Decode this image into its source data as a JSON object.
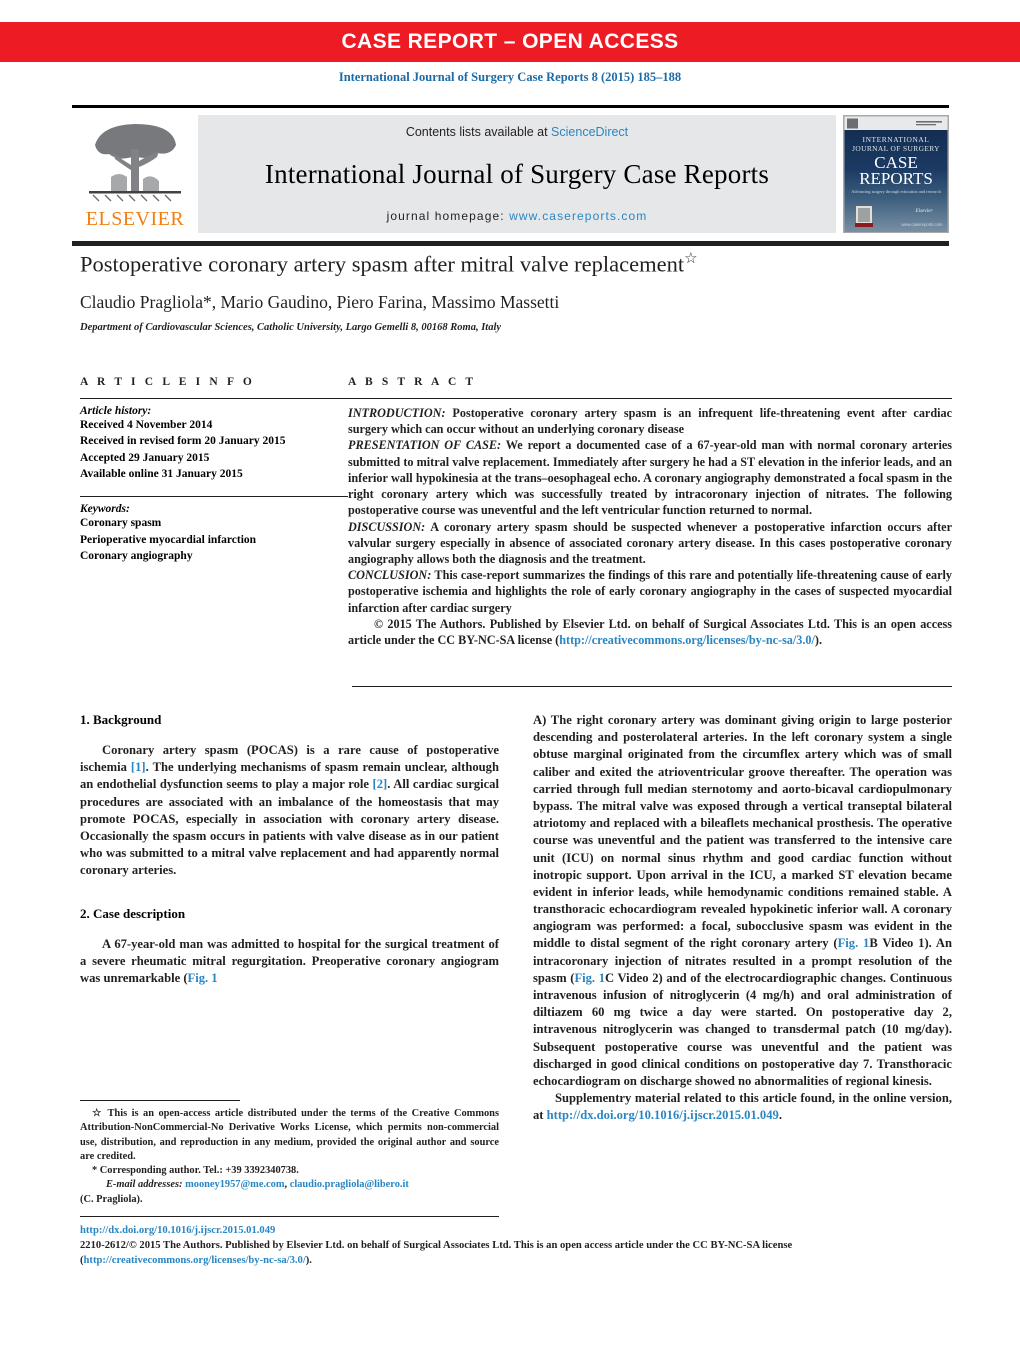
{
  "banner": {
    "label": "CASE REPORT – OPEN ACCESS",
    "color": "#ed1c24"
  },
  "running_head": "International Journal of Surgery Case Reports 8 (2015) 185–188",
  "masthead": {
    "publisher_logo_label": "ELSEVIER",
    "contents_prefix": "Contents lists available at ",
    "contents_link": "ScienceDirect",
    "journal_title": "International Journal of Surgery Case Reports",
    "homepage_prefix": "journal homepage: ",
    "homepage_url": "www.casereports.com",
    "cover": {
      "line1": "INTERNATIONAL",
      "line2": "JOURNAL OF SURGERY",
      "line3": "CASE",
      "line4": "REPORTS",
      "tagline": "Advancing surgery through education and research",
      "url": "www.casereports.com"
    }
  },
  "article": {
    "title": "Postoperative coronary artery spasm after mitral valve replacement",
    "title_mark": "☆",
    "authors": "Claudio Pragliola*, Mario Gaudino, Piero Farina, Massimo Massetti",
    "affiliation": "Department of Cardiovascular Sciences, Catholic University, Largo Gemelli 8, 00168 Roma, Italy"
  },
  "article_info": {
    "heading": "A R T I C L E   I N F O",
    "history_label": "Article history:",
    "history": [
      "Received 4 November 2014",
      "Received in revised form 20 January 2015",
      "Accepted 29 January 2015",
      "Available online 31 January 2015"
    ],
    "keywords_label": "Keywords:",
    "keywords": [
      "Coronary spasm",
      "Perioperative myocardial infarction",
      "Coronary angiography"
    ]
  },
  "abstract": {
    "heading": "A B S T R A C T",
    "sections": [
      {
        "tag": "INTRODUCTION:",
        "text": " Postoperative coronary artery spasm is an infrequent life-threatening event after cardiac surgery which can occur without an underlying coronary disease"
      },
      {
        "tag": "PRESENTATION OF CASE:",
        "text": " We report a documented case of a 67-year-old man with normal coronary arteries submitted to mitral valve replacement. Immediately after surgery he had a ST elevation in the inferior leads, and an inferior wall hypokinesia at the trans–oesophageal echo. A coronary angiography demonstrated a focal spasm in the right coronary artery which was successfully treated by intracoronary injection of nitrates. The following postoperative course was uneventful and the left ventricular function returned to normal."
      },
      {
        "tag": "DISCUSSION:",
        "text": " A coronary artery spasm should be suspected whenever a postoperative infarction occurs after valvular surgery especially in absence of associated coronary artery disease. In this cases postoperative coronary angiography allows both the diagnosis and the treatment."
      },
      {
        "tag": "CONCLUSION:",
        "text": " This case-report summarizes the findings of this rare and potentially life-threatening cause of early postoperative ischemia and highlights the role of early coronary angiography in the cases of suspected myocardial infarction after cardiac surgery"
      }
    ],
    "copyright_pre": "© 2015 The Authors. Published by Elsevier Ltd. on behalf of Surgical Associates Ltd. This is an open access article under the CC BY-NC-SA license (",
    "copyright_link": "http://creativecommons.org/licenses/by-nc-sa/3.0/",
    "copyright_post": ")."
  },
  "body": {
    "section1_heading": "1.  Background",
    "section1_para1_a": "Coronary artery spasm (POCAS) is a rare cause of postoperative ischemia ",
    "section1_ref1": "[1]",
    "section1_para1_b": ". The underlying mechanisms of spasm remain unclear, although an endothelial dysfunction seems to play a major role ",
    "section1_ref2": "[2]",
    "section1_para1_c": ". All cardiac surgical procedures are associated with an imbalance of the homeostasis that may promote POCAS, especially in association with coronary artery disease. Occasionally the spasm occurs in patients with valve disease as in our patient who was submitted to a mitral valve replacement and had apparently normal coronary arteries.",
    "section2_heading": "2.  Case description",
    "section2_para1_a": "A 67-year-old man was admitted to hospital for the surgical treatment of a severe rheumatic mitral regurgitation. Preoperative coronary angiogram was unremarkable (",
    "section2_fig1a": "Fig. 1",
    "section2_para1_b": "A) The right coronary artery was dominant giving origin to large posterior descending and posterolateral arteries. In the left coronary system a single obtuse marginal originated from the circumflex artery which was of small caliber and exited the atrioventricular groove thereafter. The operation was carried through full median sternotomy and aorto-bicaval cardiopulmonary bypass. The mitral valve was exposed through a vertical transeptal bilateral atriotomy and replaced with a bileaflets mechanical prosthesis. The operative course was uneventful and the patient was transferred to the intensive care unit (ICU) on normal sinus rhythm and good cardiac function without inotropic support. Upon arrival in the ICU, a marked ST elevation became evident in inferior leads, while hemodynamic conditions remained stable. A transthoracic echocardiogram revealed hypokinetic inferior wall. A coronary angiogram was performed: a focal, subocclusive spasm was evident in the middle to distal segment of the right coronary artery (",
    "section2_fig1b": "Fig. 1",
    "section2_para1_c": "B Video 1). An intracoronary injection of nitrates resulted in a prompt resolution of the spasm (",
    "section2_fig1c": "Fig. 1",
    "section2_para1_d": "C Video 2) and of the electrocardiographic changes. Continuous intravenous infusion of nitroglycerin (4 mg/h) and oral administration of diltiazem 60 mg twice a day were started. On postoperative day 2, intravenous nitroglycerin was changed to transdermal patch (10 mg/day). Subsequent postoperative course was uneventful and the patient was discharged in good clinical conditions on postoperative day 7. Transthoracic echocardiogram on discharge showed no abnormalities of regional kinesis.",
    "supp_para_a": "Supplementry material related to this article found, in the online version, at ",
    "supp_link": "http://dx.doi.org/10.1016/j.ijscr.2015.01.049",
    "supp_para_b": "."
  },
  "footnotes": {
    "star_mark": "☆",
    "license_note": " This is an open-access article distributed under the terms of the Creative Commons Attribution-NonCommercial-No Derivative Works License, which permits non-commercial use, distribution, and reproduction in any medium, provided the original author and source are credited.",
    "corresponding": "* Corresponding author. Tel.: +39 3392340738.",
    "email_label": "E-mail addresses:",
    "email1": "mooney1957@me.com",
    "email_sep": ", ",
    "email2": "claudio.pragliola@libero.it",
    "email_owner": "(C. Pragliola)."
  },
  "bottom": {
    "doi": "http://dx.doi.org/10.1016/j.ijscr.2015.01.049",
    "issn_line": "2210-2612/© 2015 The Authors. Published by Elsevier Ltd. on behalf of Surgical Associates Ltd. This is an open access article under the CC BY-NC-SA license",
    "license_open": "(",
    "license_link": "http://creativecommons.org/licenses/by-nc-sa/3.0/",
    "license_close": ")."
  }
}
